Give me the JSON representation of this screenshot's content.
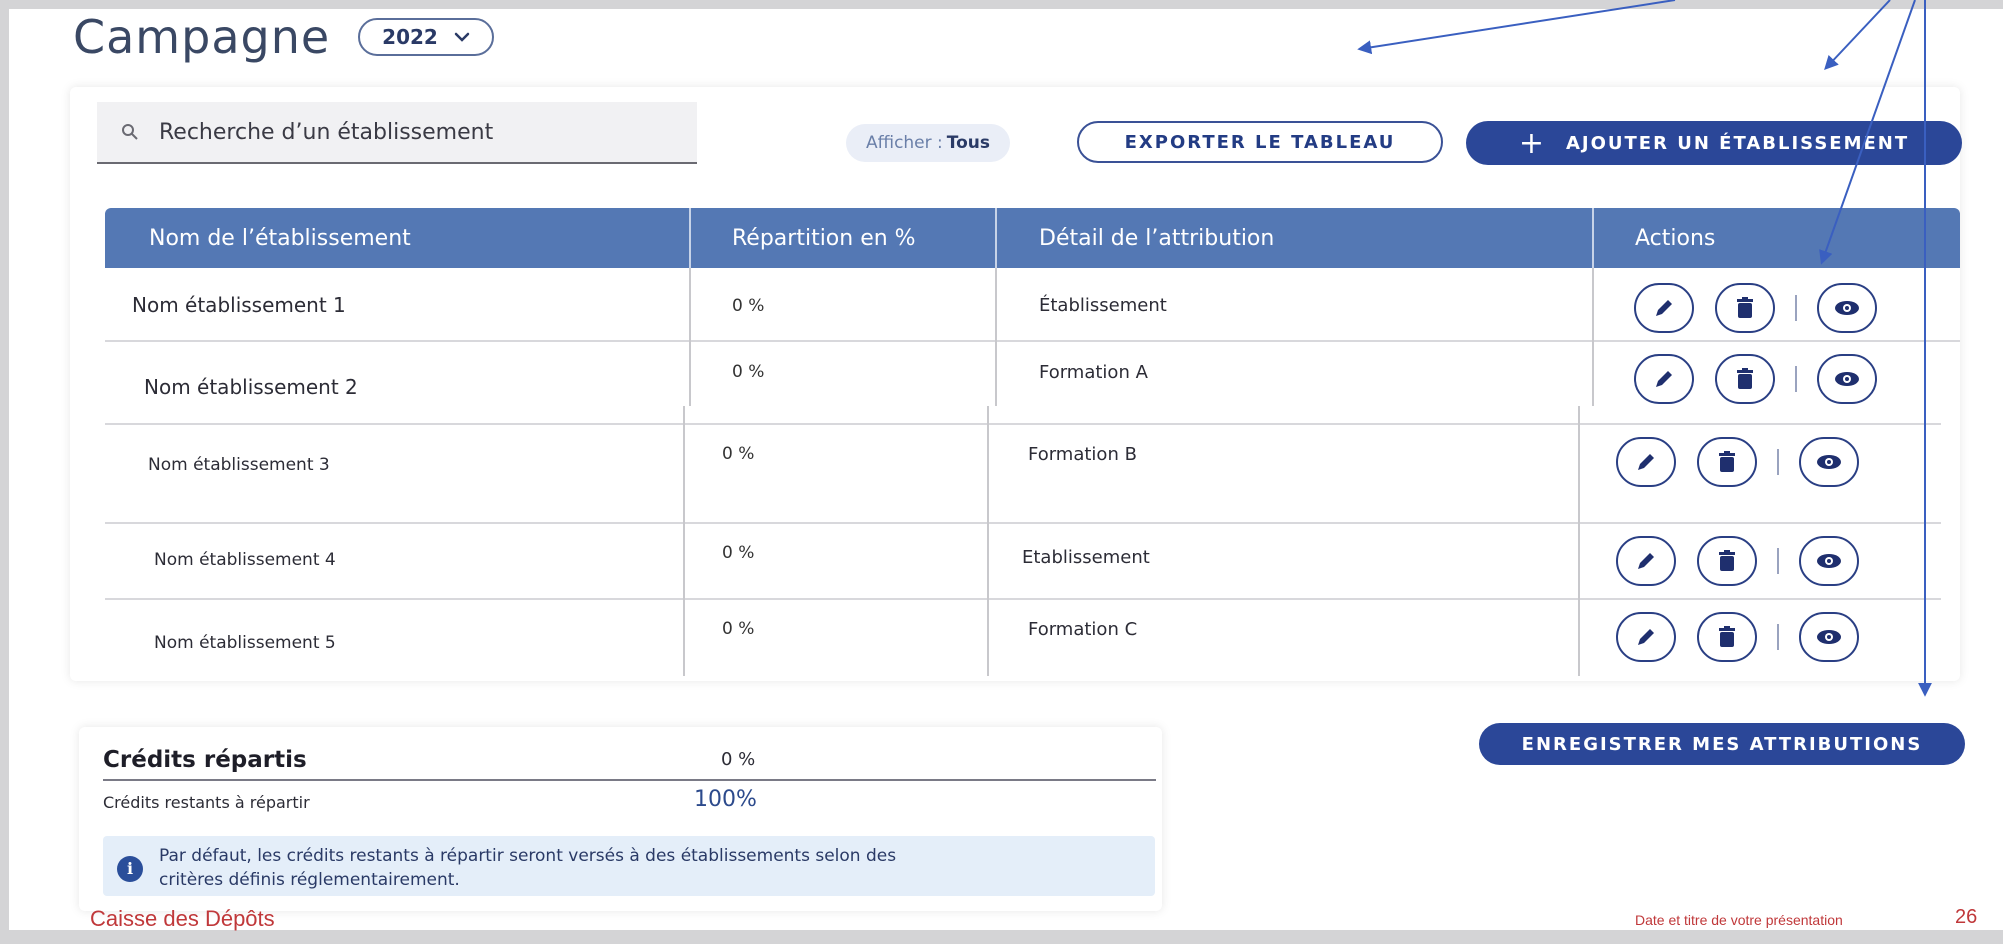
{
  "header": {
    "title": "Campagne",
    "year": "2022"
  },
  "toolbar": {
    "search_placeholder": "Recherche d’un établissement",
    "filter_label": "Afficher :",
    "filter_value": "Tous",
    "export_label": "EXPORTER LE TABLEAU",
    "add_label": "AJOUTER UN ÉTABLISSEMENT",
    "add_icon": "plus-icon"
  },
  "table": {
    "columns": [
      "Nom de l’établissement",
      "Répartition en %",
      "Détail de l’attribution",
      "Actions"
    ],
    "rows": [
      {
        "name": "Nom établissement 1",
        "pct": "0 %",
        "attr": "Établissement"
      },
      {
        "name": "Nom établissement 2",
        "pct": "0 %",
        "attr": "Formation  A"
      },
      {
        "name": "Nom établissement 3",
        "pct": "0 %",
        "attr": "Formation  B"
      },
      {
        "name": "Nom établissement 4",
        "pct": "0 %",
        "attr": "Etablissement"
      },
      {
        "name": "Nom établissement 5",
        "pct": "0 %",
        "attr": "Formation  C"
      }
    ],
    "action_icons": [
      "edit-icon",
      "delete-icon",
      "view-icon"
    ]
  },
  "credits": {
    "title": "Crédits répartis",
    "value": "0 %",
    "remaining_label": "Crédits restants à répartir",
    "remaining_value": "100%",
    "info_line1": "Par défaut, les crédits restants à répartir seront versés à des établissements selon des",
    "info_line2": "critères définis réglementairement."
  },
  "save_label": "ENREGISTRER MES ATTRIBUTIONS",
  "footer": {
    "left": "Caisse des Dépôts",
    "right": "Date et titre de votre présentation",
    "page": "26"
  },
  "colors": {
    "primary": "#2b4798",
    "table_header": "#5478b4",
    "arrow": "#3a5fc0",
    "footer": "#c0383a"
  }
}
